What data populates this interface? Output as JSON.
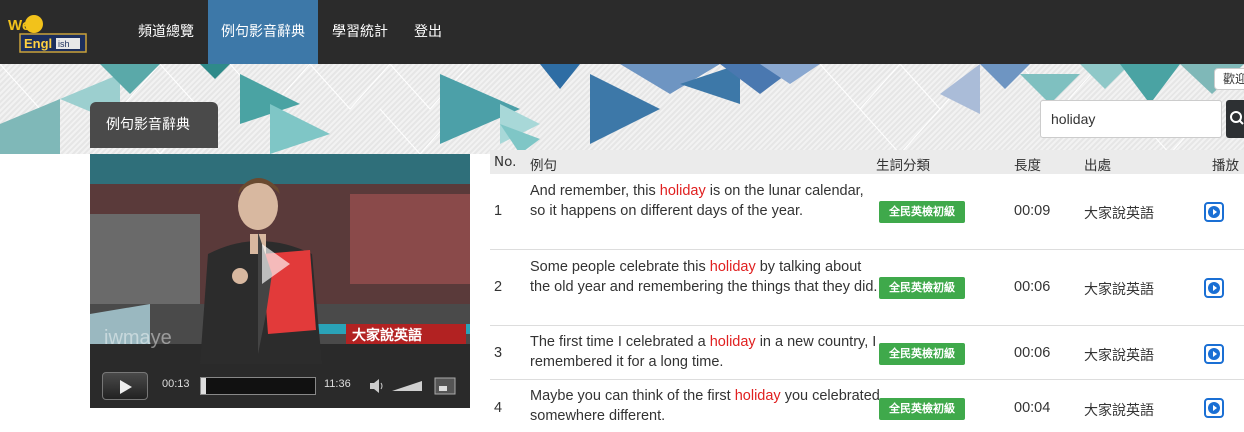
{
  "nav": {
    "logo_text": "WebEnglish",
    "items": [
      {
        "label": "頻道總覽"
      },
      {
        "label": "例句影音辭典",
        "active": true
      },
      {
        "label": "學習統計"
      },
      {
        "label": "登出"
      }
    ]
  },
  "banner": {
    "section_title": "例句影音辭典",
    "welcome": "歡迎"
  },
  "search": {
    "value": "holiday",
    "button_icon": "search-icon"
  },
  "video": {
    "overlay_logo": "大家說英語",
    "watermark": "iwmaye",
    "current_time": "00:13",
    "total_time": "11:36",
    "progress": 0.02,
    "controls": [
      "play-icon",
      "volume-icon",
      "fullscreen-icon"
    ]
  },
  "table": {
    "headers": {
      "no": "No.",
      "sentence": "例句",
      "category": "生詞分類",
      "length": "長度",
      "source": "出處",
      "play": "播放"
    },
    "rows": [
      {
        "no": "1",
        "before": "And remember, this ",
        "keyword": "holiday",
        "after": " is on the lunar calendar, so it happens on different days of the year.",
        "category": "全民英檢初級",
        "length": "00:09",
        "source": "大家說英語"
      },
      {
        "no": "2",
        "before": "Some people celebrate this ",
        "keyword": "holiday",
        "after": " by talking about the old year and remembering the things that they did.",
        "category": "全民英檢初級",
        "length": "00:06",
        "source": "大家說英語"
      },
      {
        "no": "3",
        "before": "The first time I celebrated a ",
        "keyword": "holiday",
        "after": " in a new country, I remembered it for a long time.",
        "category": "全民英檢初級",
        "length": "00:06",
        "source": "大家說英語"
      },
      {
        "no": "4",
        "before": "Maybe you can think of the first ",
        "keyword": "holiday",
        "after": " you celebrated somewhere different.",
        "category": "全民英檢初級",
        "length": "00:04",
        "source": "大家說英語"
      }
    ]
  },
  "colors": {
    "nav_bg": "#2b2b2b",
    "nav_active": "#3d78a8",
    "keyword": "#e02020",
    "badge": "#3fa94b",
    "play_button": "#1a6fd4"
  }
}
